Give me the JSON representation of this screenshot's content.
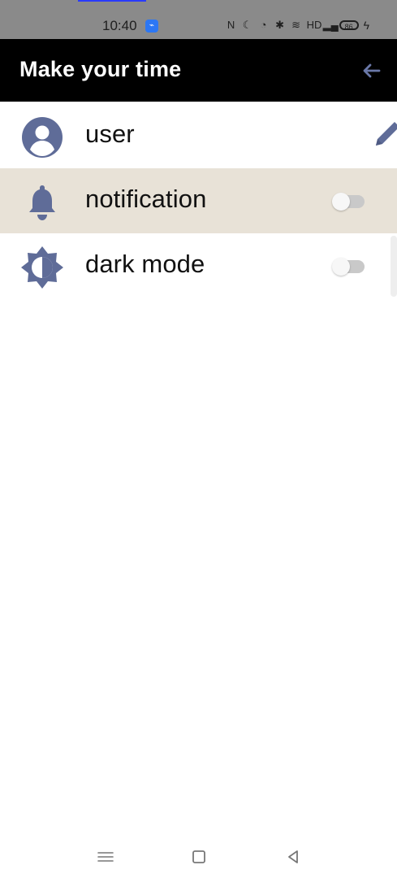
{
  "status_bar": {
    "time": "10:40",
    "battery": "86",
    "icons": [
      "nfc-icon",
      "moon-icon",
      "alarm-icon",
      "bluetooth-icon",
      "wifi-icon",
      "hd-icon",
      "signal-icon",
      "battery-icon",
      "charging-bolt-icon"
    ],
    "app_badge_icon": "app-status-icon"
  },
  "app_bar": {
    "title": "Make your time",
    "back_icon": "arrow-left-icon"
  },
  "settings": [
    {
      "name": "user",
      "label": "user",
      "icon": "account-circle-icon",
      "action_icon": "edit-pencil-icon"
    },
    {
      "name": "notification",
      "label": "notification",
      "icon": "bell-icon",
      "toggle": {
        "state": "off"
      }
    },
    {
      "name": "dark-mode",
      "label": "dark mode",
      "icon": "brightness-icon",
      "toggle": {
        "state": "off"
      }
    }
  ],
  "navigation_bar": {
    "icons": [
      "menu-icon",
      "home-square-icon",
      "back-triangle-icon"
    ]
  },
  "colors": {
    "status_bar": "#8a8a8a",
    "app_bar": "#000000",
    "accent_icon": "#5f6c98",
    "selected_row": "#e8e2d7",
    "text": "#111111",
    "background": "#ffffff"
  }
}
